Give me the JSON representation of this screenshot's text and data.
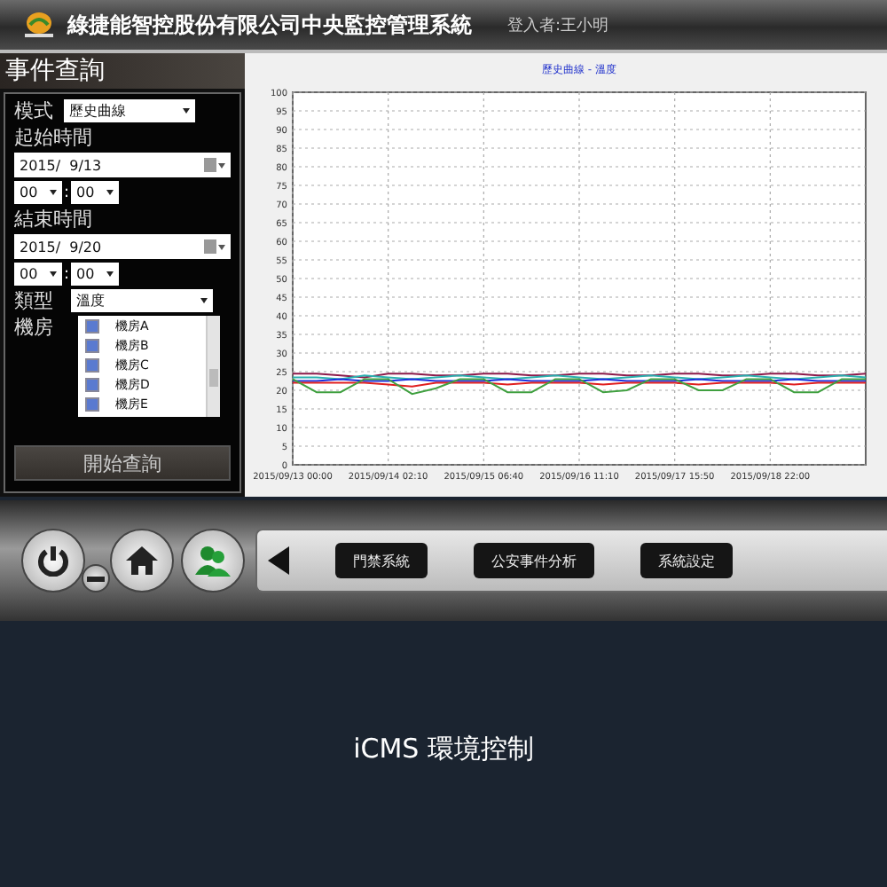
{
  "header": {
    "title": "綠捷能智控股份有限公司中央監控管理系統",
    "user": "登入者:王小明"
  },
  "query_panel": {
    "title": "事件查詢",
    "mode": {
      "label": "模式",
      "value": "歷史曲線"
    },
    "start": {
      "label": "起始時間",
      "date": "2015/  9/13",
      "hour": "00",
      "separator": ":",
      "minute": "00"
    },
    "end": {
      "label": "結束時間",
      "date": "2015/  9/20",
      "hour": "00",
      "separator": ":",
      "minute": "00"
    },
    "type": {
      "label": "類型",
      "value": "溫度"
    },
    "rooms": {
      "label": "機房",
      "items": [
        {
          "name": "機房A",
          "checked": true
        },
        {
          "name": "機房B",
          "checked": true
        },
        {
          "name": "機房C",
          "checked": true
        },
        {
          "name": "機房D",
          "checked": true
        },
        {
          "name": "機房E",
          "checked": true
        }
      ]
    },
    "submit": "開始查詢"
  },
  "chart": {
    "chart_data": {
      "type": "line",
      "title": "歷史曲線 - 溫度",
      "categories": [
        "2015/09/13 00:00",
        null,
        null,
        null,
        "2015/09/14 02:10",
        null,
        null,
        null,
        "2015/09/15 06:40",
        null,
        null,
        null,
        "2015/09/16 11:10",
        null,
        null,
        null,
        "2015/09/17 15:50",
        null,
        null,
        null,
        "2015/09/18 22:00",
        null,
        null,
        null,
        null
      ],
      "ylim": [
        0,
        100
      ],
      "grid": true,
      "yticks": [
        0,
        5,
        10,
        15,
        20,
        25,
        30,
        35,
        40,
        45,
        50,
        55,
        60,
        65,
        70,
        75,
        80,
        85,
        90,
        95,
        100
      ],
      "series": [
        {
          "color": "#8b1a4a",
          "values": [
            24.5,
            24.5,
            24,
            23.5,
            24.5,
            24.5,
            24,
            24,
            24.5,
            24.5,
            24,
            24,
            24.5,
            24.5,
            24,
            24,
            24.5,
            24.5,
            24,
            24,
            24.5,
            24.5,
            24,
            24,
            24.5
          ]
        },
        {
          "color": "#2ab0b0",
          "values": [
            23.5,
            23.5,
            23,
            24,
            23.5,
            23,
            23.5,
            24,
            23.5,
            23,
            23.5,
            24,
            23.5,
            23,
            23.5,
            24,
            23.5,
            23,
            23.5,
            24,
            23.5,
            23,
            23.5,
            24,
            23.5
          ]
        },
        {
          "color": "#1a2ee0",
          "values": [
            22.5,
            22.5,
            23,
            22.5,
            22.5,
            23,
            22.5,
            22.5,
            22.5,
            23,
            22.5,
            22.5,
            22.5,
            23,
            22.5,
            22.5,
            22.5,
            23,
            22.5,
            22.5,
            22.5,
            23,
            22.5,
            22.5,
            22.5
          ]
        },
        {
          "color": "#e02020",
          "values": [
            22,
            22,
            22,
            22,
            21.5,
            21,
            22,
            22,
            22,
            21.5,
            22,
            22,
            22,
            21.5,
            22,
            22,
            22,
            21.5,
            22,
            22,
            22,
            21.5,
            22,
            22,
            22
          ]
        },
        {
          "color": "#40a040",
          "values": [
            23,
            19.5,
            19.5,
            23,
            23,
            19,
            20.5,
            23,
            23,
            19.5,
            19.5,
            23,
            23,
            19.5,
            20,
            23,
            23,
            20,
            20,
            23,
            23,
            19.5,
            19.5,
            23,
            23
          ]
        }
      ]
    }
  },
  "toolbar": {
    "nav_buttons": [
      "門禁系統",
      "公安事件分析",
      "系統設定"
    ]
  },
  "caption": "iCMS 環境控制"
}
